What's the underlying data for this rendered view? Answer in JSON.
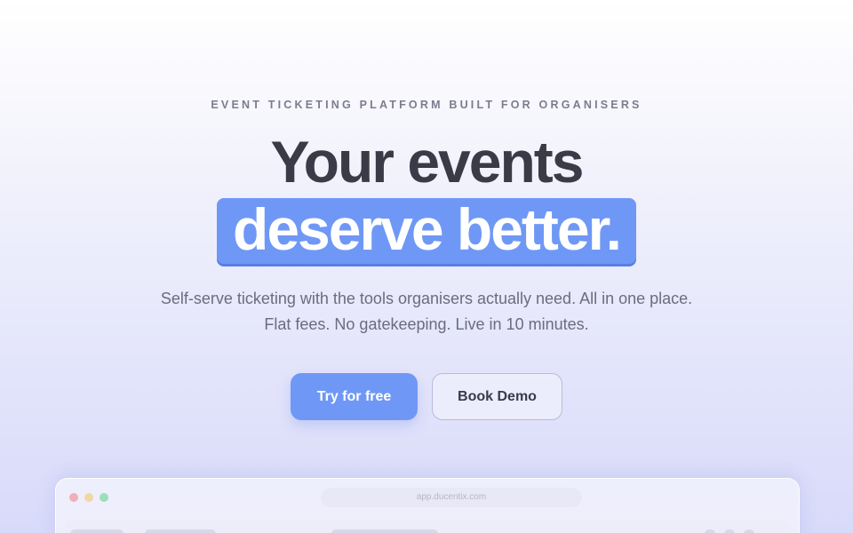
{
  "hero": {
    "eyebrow": "EVENT TICKETING PLATFORM BUILT FOR ORGANISERS",
    "headline_line1": "Your events",
    "headline_line2": "deserve better.",
    "subtext": "Self-serve ticketing with the tools organisers actually need. All in one place. Flat fees. No gatekeeping. Live in 10 minutes."
  },
  "cta": {
    "primary_label": "Try for free",
    "secondary_label": "Book Demo"
  },
  "preview": {
    "url": "app.ducentix.com"
  },
  "colors": {
    "accent": "#6f98f6",
    "heading": "#3a3b47",
    "body_text": "#6b6d7c"
  }
}
